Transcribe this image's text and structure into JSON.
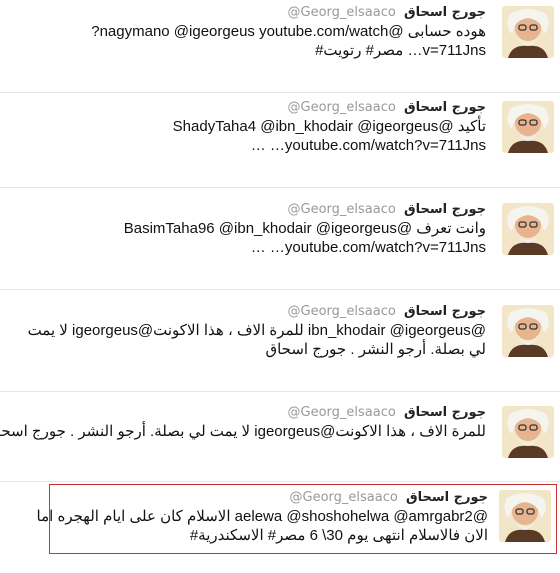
{
  "author": {
    "name": "جورج اسحاق",
    "handle": "@Georg_elsaaco"
  },
  "tweets": [
    {
      "lines": [
        "هوده حسابى @nagymano @igeorgeus youtube.com/watch?",
        "v=711Jns… مصر# رتويت#"
      ]
    },
    {
      "lines": [
        "تأكيد @ShadyTaha4 @ibn_khodair @igeorgeus",
        "youtube.com/watch?v=711Jns… …"
      ]
    },
    {
      "lines": [
        "وانت تعرف @BasimTaha96 @ibn_khodair @igeorgeus",
        "youtube.com/watch?v=711Jns… …"
      ]
    },
    {
      "lines": [
        "@ibn_khodair @igeorgeus للمرة الاف ، هذا الاكونت@igeorgeus لا يمت",
        "لي بصلة. أرجو النشر . جورج اسحاق"
      ]
    },
    {
      "lines": [
        "للمرة الاف ، هذا الاكونت@igeorgeus لا يمت لي بصلة. أرجو النشر . جورج اسحاق"
      ]
    },
    {
      "lines": [
        "@aelewa @shoshohelwa @amrgabr2 الاسلام كان على ايام الهجره اما",
        "الان فالاسلام انتهى يوم 30\\ 6 مصر# الاسكندرية#"
      ]
    }
  ]
}
